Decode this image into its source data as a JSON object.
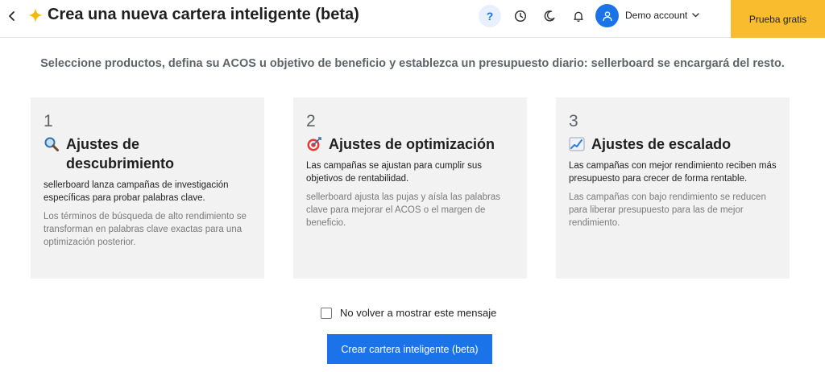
{
  "header": {
    "title": "Crea una nueva cartera inteligente (beta)",
    "help_label": "?",
    "account_label": "Demo account",
    "trial_label": "Prueba gratis"
  },
  "subtitle": "Seleccione productos, defina su ACOS u objetivo de beneficio y establezca un presupuesto diario: sellerboard se encargará del resto.",
  "cards": [
    {
      "number": "1",
      "icon": "magnifier-icon",
      "title": "Ajustes de descubrimiento",
      "main": "sellerboard lanza campañas de investigación específicas para probar palabras clave.",
      "sub": "Los términos de búsqueda de alto rendimiento se transforman en palabras clave exactas para una optimización posterior."
    },
    {
      "number": "2",
      "icon": "target-icon",
      "title": "Ajustes de optimización",
      "main": "Las campañas se ajustan para cumplir sus objetivos de rentabilidad.",
      "sub": "sellerboard ajusta las pujas y aísla las palabras clave para mejorar el ACOS o el margen de beneficio."
    },
    {
      "number": "3",
      "icon": "chart-up-icon",
      "title": "Ajustes de escalado",
      "main": "Las campañas con mejor rendimiento reciben más presupuesto para crecer de forma rentable.",
      "sub": "Las campañas con bajo rendimiento se reducen para liberar presupuesto para las de mejor rendimiento."
    }
  ],
  "checkbox_label": "No volver a mostrar este mensaje",
  "cta_label": "Crear cartera inteligente (beta)",
  "colors": {
    "accent": "#1a73e8",
    "trial": "#f8bc2e",
    "card_bg": "#f2f2f2",
    "sparkle": "#f5b90a"
  }
}
